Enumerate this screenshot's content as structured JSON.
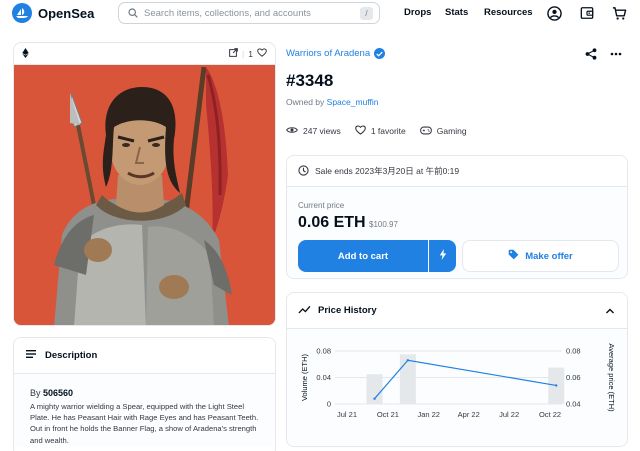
{
  "header": {
    "brand": "OpenSea",
    "search_placeholder": "Search items, collections, and accounts",
    "search_shortcut": "/",
    "nav": [
      "Drops",
      "Stats",
      "Resources"
    ],
    "icons": [
      "account-icon",
      "wallet-icon",
      "cart-icon"
    ]
  },
  "image_card": {
    "favorites_count": "1",
    "chain_icon": "ethereum-icon"
  },
  "description": {
    "heading": "Description",
    "by_label": "By",
    "by_name": "506560",
    "text": "A mighty warrior wielding a Spear, equipped with the Light Steel Plate. He has Peasant Hair with Rage Eyes and has Peasant Teeth. Out in front he holds the Banner Flag, a show of Aradena's strength and wealth."
  },
  "item": {
    "collection": "Warriors of Aradena",
    "title": "#3348",
    "owned_by_label": "Owned by",
    "owner": "Space_muffin",
    "views": "247 views",
    "favorites": "1 favorite",
    "category": "Gaming"
  },
  "sale": {
    "ends_text": "Sale ends 2023年3月20日 at 午前0:19",
    "current_price_label": "Current price",
    "price": "0.06 ETH",
    "usd": "$100.97",
    "add_to_cart": "Add to cart",
    "make_offer": "Make offer"
  },
  "price_history": {
    "heading": "Price History"
  },
  "colors": {
    "accent": "#2081e2",
    "artwork_background": "#d9553a",
    "text": "#04111d"
  },
  "chart_data": {
    "type": "bar",
    "title": "Price History",
    "xlabel": "",
    "ylabel": "Volume (ETH)",
    "ylabel_right": "Average price (ETH)",
    "x_ticks": [
      "Jul 21",
      "Oct 21",
      "Jan 22",
      "Apr 22",
      "Jul 22",
      "Oct 22"
    ],
    "y_ticks_left": [
      "0",
      "0.04",
      "0.08"
    ],
    "y_ticks_right": [
      "0.04",
      "0.06",
      "0.08"
    ],
    "ylim_left": [
      0,
      0.08
    ],
    "ylim_right": [
      0.04,
      0.08
    ],
    "series": [
      {
        "kind": "bar",
        "axis": "left",
        "x": [
          "2021-09-01",
          "2021-11-15",
          "2022-10-15"
        ],
        "values": [
          0.045,
          0.075,
          0.055
        ]
      },
      {
        "kind": "line",
        "axis": "right",
        "x": [
          "2021-09-01",
          "2021-11-15",
          "2022-10-15"
        ],
        "values": [
          0.044,
          0.073,
          0.054
        ]
      }
    ],
    "grid": true
  }
}
